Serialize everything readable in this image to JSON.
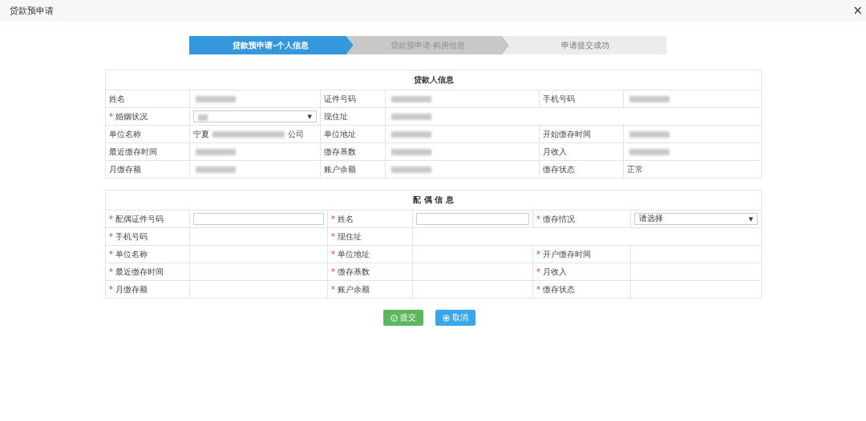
{
  "window": {
    "title": "贷款预申请",
    "close": "×"
  },
  "steps": [
    {
      "label": "贷款预申请-个人信息",
      "selected": true
    },
    {
      "label": "贷款预申请-购房信息",
      "selected": false
    },
    {
      "label": "申请提交成功",
      "selected": false
    }
  ],
  "tables": [
    {
      "title": "贷款人信息",
      "rows": [
        [
          {
            "kind": "label",
            "text": "姓名"
          },
          {
            "kind": "blur"
          },
          {
            "kind": "label",
            "text": "证件号码"
          },
          {
            "kind": "blur"
          },
          {
            "kind": "label",
            "text": "手机号码"
          },
          {
            "kind": "blur"
          }
        ],
        [
          {
            "kind": "label",
            "text": "婚姻状况",
            "mark": "*"
          },
          {
            "kind": "select",
            "arrow": "▼",
            "blurred": true
          },
          {
            "kind": "label",
            "text": "现住址"
          },
          {
            "kind": "blur"
          }
        ],
        [
          {
            "kind": "label",
            "text": "单位名称"
          },
          {
            "kind": "partial",
            "prefix": "宁夏",
            "suffix": "公司"
          },
          {
            "kind": "label",
            "text": "单位地址"
          },
          {
            "kind": "blur"
          },
          {
            "kind": "label",
            "text": "开始缴存时间"
          },
          {
            "kind": "blur"
          }
        ],
        [
          {
            "kind": "label",
            "text": "最近缴存时间"
          },
          {
            "kind": "blur"
          },
          {
            "kind": "label",
            "text": "缴存基数"
          },
          {
            "kind": "blur"
          },
          {
            "kind": "label",
            "text": "月收入"
          },
          {
            "kind": "blur"
          }
        ],
        [
          {
            "kind": "label",
            "text": "月缴存额"
          },
          {
            "kind": "blur"
          },
          {
            "kind": "label",
            "text": "账户余额"
          },
          {
            "kind": "blur"
          },
          {
            "kind": "label",
            "text": "缴存状态"
          },
          {
            "kind": "text",
            "text": "正常"
          }
        ]
      ]
    },
    {
      "title": "配 偶 信 息",
      "rows": [
        [
          {
            "kind": "label",
            "text": "配偶证件号码",
            "mark": "*"
          },
          {
            "kind": "input"
          },
          {
            "kind": "label",
            "text": "姓名",
            "mark": "*"
          },
          {
            "kind": "input"
          },
          {
            "kind": "label",
            "text": "缴存情况",
            "mark": "*"
          },
          {
            "kind": "select",
            "value": "请选择",
            "arrow": "▼"
          }
        ],
        [
          {
            "kind": "label",
            "text": "手机号码",
            "mark": "*"
          },
          {
            "kind": "empty"
          },
          {
            "kind": "label",
            "text": "现住址",
            "mark": "*"
          },
          {
            "kind": "empty"
          }
        ],
        [
          {
            "kind": "label",
            "text": "单位名称",
            "mark": "*"
          },
          {
            "kind": "empty"
          },
          {
            "kind": "label",
            "text": "单位地址",
            "mark": "*"
          },
          {
            "kind": "empty"
          },
          {
            "kind": "label",
            "text": "开户缴存时间",
            "mark": "*"
          },
          {
            "kind": "empty"
          }
        ],
        [
          {
            "kind": "label",
            "text": "最近缴存时间",
            "mark": "*"
          },
          {
            "kind": "empty"
          },
          {
            "kind": "label",
            "text": "缴存基数",
            "mark": "*"
          },
          {
            "kind": "empty"
          },
          {
            "kind": "label",
            "text": "月收入",
            "mark": "*"
          },
          {
            "kind": "empty"
          }
        ],
        [
          {
            "kind": "label",
            "text": "月缴存额",
            "mark": "*"
          },
          {
            "kind": "empty"
          },
          {
            "kind": "label",
            "text": "账户余额",
            "mark": "*"
          },
          {
            "kind": "empty"
          },
          {
            "kind": "label",
            "text": "缴存状态",
            "mark": "*"
          },
          {
            "kind": "empty"
          }
        ]
      ]
    }
  ],
  "buttons": [
    {
      "label": "提交",
      "kind": "submit"
    },
    {
      "label": "取消",
      "kind": "cancel"
    }
  ]
}
